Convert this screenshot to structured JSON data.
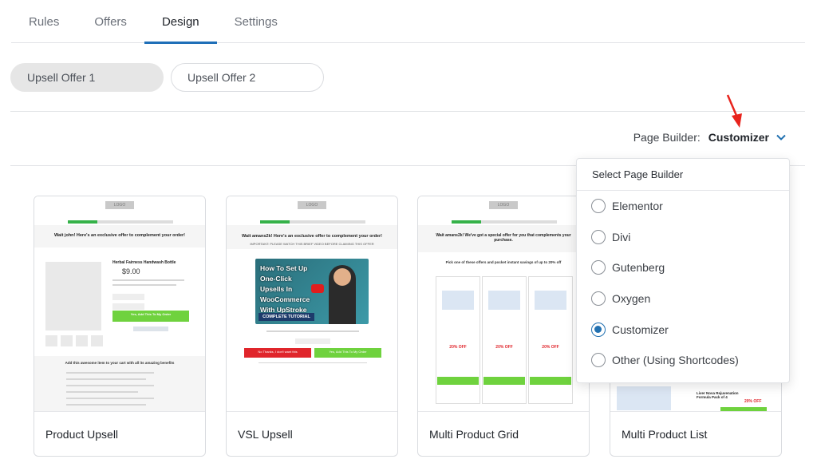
{
  "tabs": [
    {
      "label": "Rules"
    },
    {
      "label": "Offers"
    },
    {
      "label": "Design",
      "active": true
    },
    {
      "label": "Settings"
    }
  ],
  "offers": [
    {
      "label": "Upsell Offer 1",
      "selected": true
    },
    {
      "label": "Upsell Offer 2",
      "selected": false
    }
  ],
  "page_builder": {
    "label": "Page Builder:",
    "value": "Customizer"
  },
  "dropdown": {
    "title": "Select Page Builder",
    "options": [
      {
        "label": "Elementor",
        "checked": false
      },
      {
        "label": "Divi",
        "checked": false
      },
      {
        "label": "Gutenberg",
        "checked": false
      },
      {
        "label": "Oxygen",
        "checked": false
      },
      {
        "label": "Customizer",
        "checked": true
      },
      {
        "label": "Other (Using Shortcodes)",
        "checked": false
      }
    ]
  },
  "templates": [
    {
      "caption": "Product Upsell",
      "logo": "LOGO",
      "headline": "Wait john! Here's an exclusive offer to complement your order!",
      "product_title": "Herbal Fairness Handwash Bottle",
      "price": "$9.00",
      "cta": "Yes, Add This To My Order",
      "benefits_title": "Add this awesome item to your cart with all its amazing benefits"
    },
    {
      "caption": "VSL Upsell",
      "logo": "LOGO",
      "headline": "Wait amans2k! Here's an exclusive offer to complement your order!",
      "notice": "IMPORTANT: PLEASE WATCH THIS BRIEF VIDEO BEFORE CLAIMING THIS OFFER",
      "video_text": "How To Set Up One-Click Upsells In WooCommerce With UpStroke",
      "video_badge": "COMPLETE TUTORIAL",
      "no_button": "No Thanks, I don't want this",
      "yes_button": "Yes, Add This To My Order"
    },
    {
      "caption": "Multi Product Grid",
      "logo": "LOGO",
      "headline": "Wait amans2k! We've got a special offer for you that complements your purchase.",
      "pick_text": "Pick one of these offers and pocket instant savings of up to 20% off",
      "discount": "20% OFF"
    },
    {
      "caption": "Multi Product List",
      "product_title": "Liver Nova Rejuvenation Formula Pack of 4",
      "discount": "20% OFF"
    }
  ],
  "colors": {
    "accent": "#1f6fb8",
    "radio": "#2271b1",
    "arrow": "#e8231c",
    "cta_green": "#6fd23e",
    "cta_red": "#e0252b"
  }
}
